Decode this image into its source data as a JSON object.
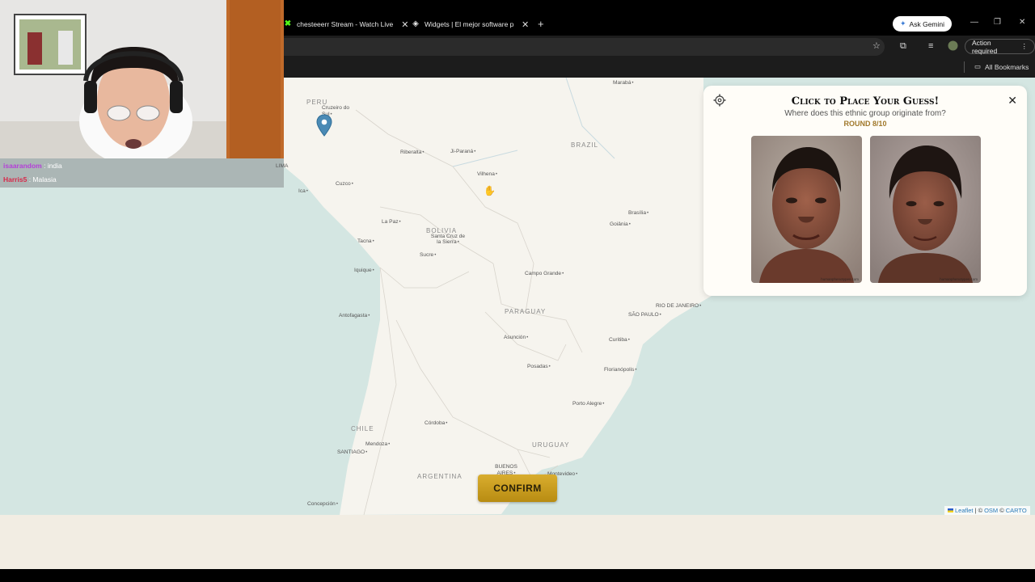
{
  "browser": {
    "tabs": [
      {
        "label": "chesteeerr Stream - Watch Live",
        "favicon": "kick-icon"
      },
      {
        "label": "Widgets | El mejor software pa",
        "favicon": "widget-icon"
      }
    ],
    "ask_gemini": "Ask Gemini",
    "action_required": "Action required",
    "all_bookmarks": "All Bookmarks"
  },
  "map": {
    "countries": [
      {
        "name": "PERU"
      },
      {
        "name": "BRAZIL"
      },
      {
        "name": "BOLIVIA"
      },
      {
        "name": "PARAGUAY"
      },
      {
        "name": "CHILE"
      },
      {
        "name": "URUGUAY"
      },
      {
        "name": "ARGENTINA"
      }
    ],
    "cities": [
      "Marabá",
      "Cruzeiro do Sul",
      "Riberalta",
      "Ji-Paraná",
      "Vilhena",
      "Cuzco",
      "Ica",
      "La Paz",
      "Santa Cruz de la Sierra",
      "Tacna",
      "Sucre",
      "Iquique",
      "Brasília",
      "Goiânia",
      "Campo Grande",
      "Antofagasta",
      "RIO DE JANEIRO",
      "SÃO PAULO",
      "Asunción",
      "Curitiba",
      "Posadas",
      "Florianópolis",
      "Porto Alegre",
      "Córdoba",
      "Mendoza",
      "SANTIAGO",
      "BUENOS AIRES",
      "Montevideo",
      "Concepción"
    ],
    "confirm_label": "CONFIRM",
    "attribution": {
      "leaflet": "Leaflet",
      "sep": "| ©",
      "osm": "OSM",
      "copy": "©",
      "carto": "CARTO"
    }
  },
  "panel": {
    "title": "Click to Place Your Guess!",
    "subtitle": "Where does this ethnic group originate from?",
    "round": "ROUND 8/10",
    "watermark": "humanphenotypes.com"
  },
  "chat": {
    "messages": [
      {
        "user": "isaarandom",
        "text": ": india"
      },
      {
        "user": "Harris5",
        "text": ": Malasia"
      }
    ],
    "lima": "LIMA"
  },
  "colors": {
    "confirm": "#c99d1f",
    "accent_round": "#a0782a",
    "pin": "#4a8ab5",
    "ocean": "#d4e6e2",
    "land": "#f6f4ee"
  }
}
